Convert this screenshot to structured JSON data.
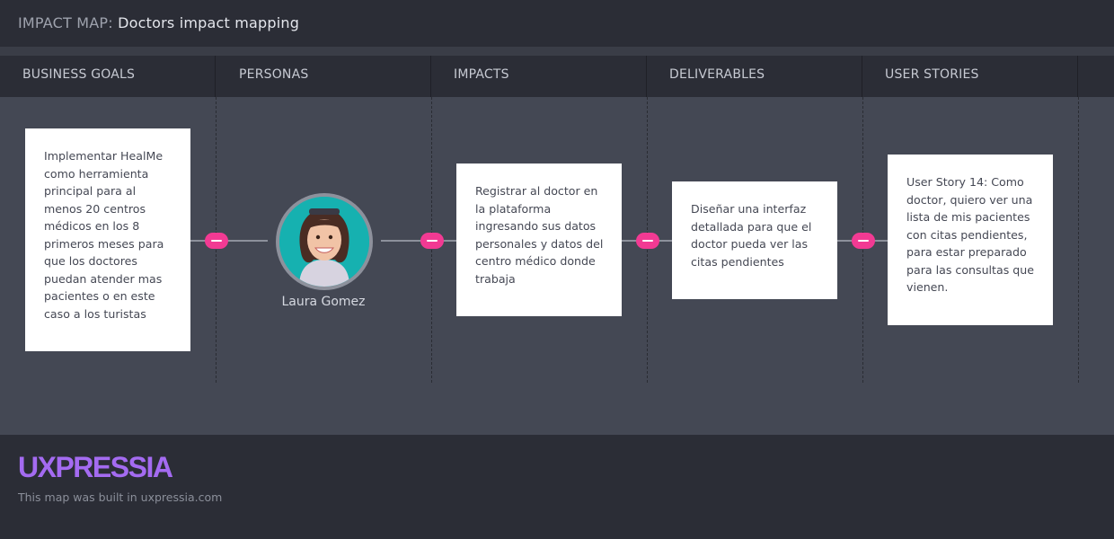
{
  "header": {
    "prefix": "IMPACT MAP:",
    "title": "Doctors impact mapping"
  },
  "columns": [
    "BUSINESS GOALS",
    "PERSONAS",
    "IMPACTS",
    "DELIVERABLES",
    "USER STORIES"
  ],
  "business_goal": {
    "lines": [
      "Implementar HealMe",
      "como herramienta",
      "principal para al",
      "menos 20 centros",
      "médicos en los 8",
      "primeros meses para",
      "que los doctores",
      "puedan atender mas",
      "pacientes o en este",
      "caso a los turistas"
    ]
  },
  "persona": {
    "name": "Laura Gomez",
    "avatar_icon": "user-photo-icon"
  },
  "impact": {
    "lines": [
      "Registrar al doctor en",
      "la plataforma",
      "ingresando sus datos",
      "personales y datos del",
      "centro médico donde",
      "trabaja"
    ]
  },
  "deliverable": {
    "lines": [
      "Diseñar una interfaz",
      "detallada para que el",
      "doctor pueda ver las",
      "citas pendientes"
    ]
  },
  "user_story": {
    "lines": [
      "User Story 14: Como",
      "doctor, quiero ver una",
      "lista de mis pacientes",
      "con citas pendientes,",
      "para estar preparado",
      "para las consultas que",
      "vienen."
    ]
  },
  "footer": {
    "logo": "UXPRESSIA",
    "note": "This map was built in uxpressia.com"
  },
  "colors": {
    "accent": "#f23a93",
    "brand": "#a46bf1",
    "avatar_bg": "#16b1b0"
  }
}
